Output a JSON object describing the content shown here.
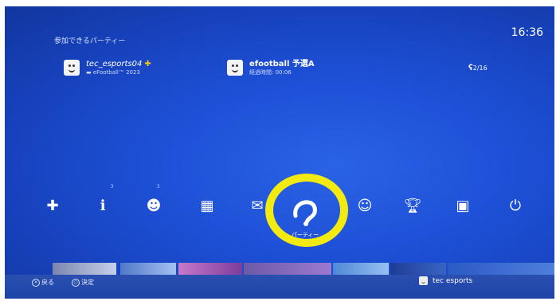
{
  "clock": "16:36",
  "party_section": {
    "title": "参加できるパーティー",
    "host": {
      "name": "tec_esports04",
      "plus_icon": "plus-icon",
      "game": "eFootball™ 2023"
    },
    "party": {
      "name": "efootball 予選A",
      "elapsed": "経過時間: 00:06"
    },
    "member_count": "2/16"
  },
  "function_bar": {
    "items": [
      {
        "name": "playstation-store-icon"
      },
      {
        "name": "notifications-icon",
        "badge": "3"
      },
      {
        "name": "friends-icon",
        "badge": "3"
      },
      {
        "name": "events-icon"
      },
      {
        "name": "messages-icon"
      },
      {
        "name": "party-icon",
        "label": "パーティー",
        "selected": true
      },
      {
        "name": "profile-icon"
      },
      {
        "name": "trophies-icon"
      },
      {
        "name": "settings-icon"
      },
      {
        "name": "power-icon"
      }
    ],
    "highlight_color": "#f2ea10"
  },
  "hints": {
    "back": "戻る",
    "confirm": "決定"
  },
  "user": {
    "name": "tec esports"
  },
  "colors": {
    "background": "#1d4fd6",
    "plus": "#f6c21b"
  }
}
